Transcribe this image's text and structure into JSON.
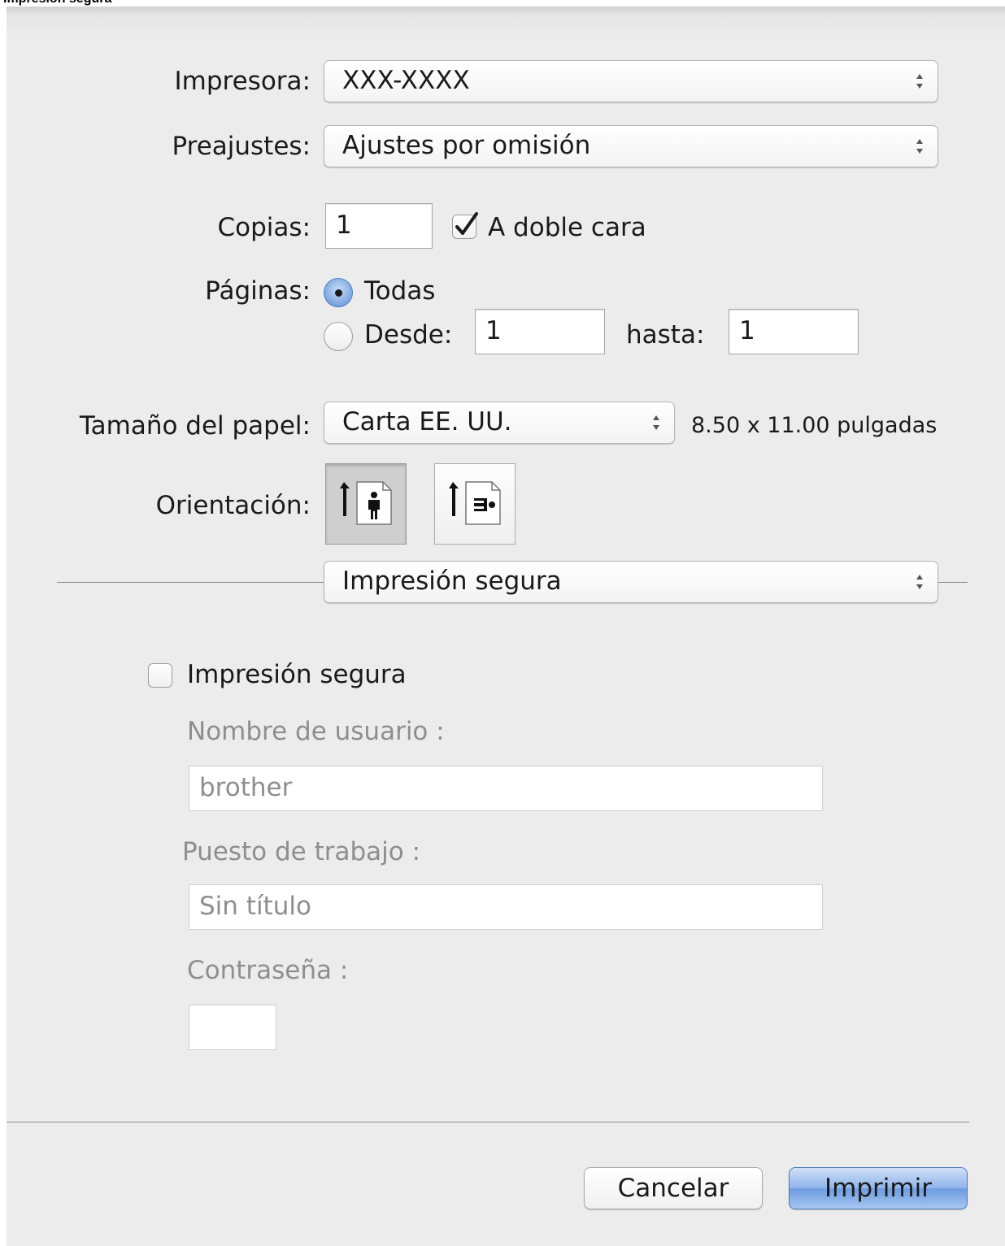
{
  "caption": "Impresión segura",
  "printer": {
    "label": "Impresora:",
    "value": "XXX-XXXX"
  },
  "presets": {
    "label": "Preajustes:",
    "value": "Ajustes por omisión"
  },
  "copies": {
    "label": "Copias:",
    "value": "1",
    "duplex_label": "A doble cara",
    "duplex_checked": true
  },
  "pages": {
    "label": "Páginas:",
    "all_label": "Todas",
    "from_label": "Desde:",
    "from_value": "1",
    "to_label": "hasta:",
    "to_value": "1",
    "selected": "all"
  },
  "paper_size": {
    "label": "Tamaño del papel:",
    "value": "Carta EE. UU.",
    "dimensions": "8.50 x 11.00 pulgadas"
  },
  "orientation": {
    "label": "Orientación:",
    "options": [
      "portrait-icon",
      "landscape-icon"
    ],
    "selected": "portrait"
  },
  "section_popup": {
    "value": "Impresión segura"
  },
  "secure": {
    "checkbox_label": "Impresión segura",
    "checked": false,
    "username_label": "Nombre de usuario :",
    "username_value": "brother",
    "job_label": "Puesto de trabajo :",
    "job_value": "Sin título",
    "password_label": "Contraseña :",
    "password_value": ""
  },
  "buttons": {
    "cancel": "Cancelar",
    "print": "Imprimir"
  },
  "colors": {
    "accent": "#6d9ce0",
    "dialog_bg": "#ececec",
    "disabled_text": "#8e8e8e"
  }
}
